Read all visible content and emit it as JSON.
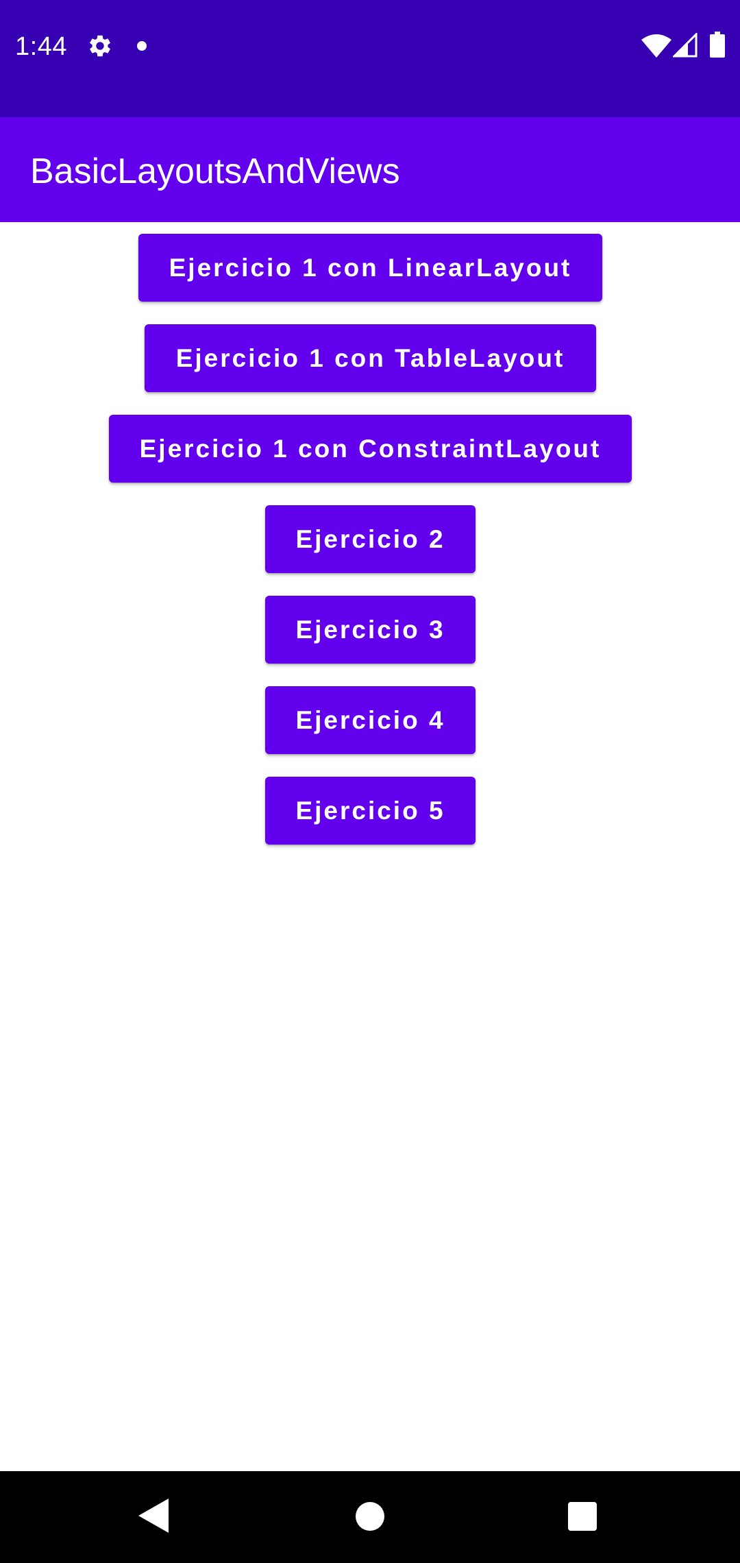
{
  "status_bar": {
    "time": "1:44",
    "icons": [
      "gear-icon",
      "notification-dot-icon",
      "wifi-icon",
      "cell-signal-icon",
      "battery-icon"
    ]
  },
  "app_bar": {
    "title": "BasicLayoutsAndViews"
  },
  "buttons": [
    {
      "label": "Ejercicio 1 con LinearLayout"
    },
    {
      "label": "Ejercicio 1 con TableLayout"
    },
    {
      "label": "Ejercicio 1 con ConstraintLayout"
    },
    {
      "label": "Ejercicio 2"
    },
    {
      "label": "Ejercicio 3"
    },
    {
      "label": "Ejercicio 4"
    },
    {
      "label": "Ejercicio 5"
    }
  ],
  "nav_bar": {
    "icons": [
      "back-icon",
      "home-icon",
      "recents-icon"
    ]
  },
  "colors": {
    "status_bar": "#3700B3",
    "primary": "#6200EE",
    "on_primary": "#FFFFFF",
    "background": "#FFFFFF",
    "nav_bar": "#000000"
  }
}
